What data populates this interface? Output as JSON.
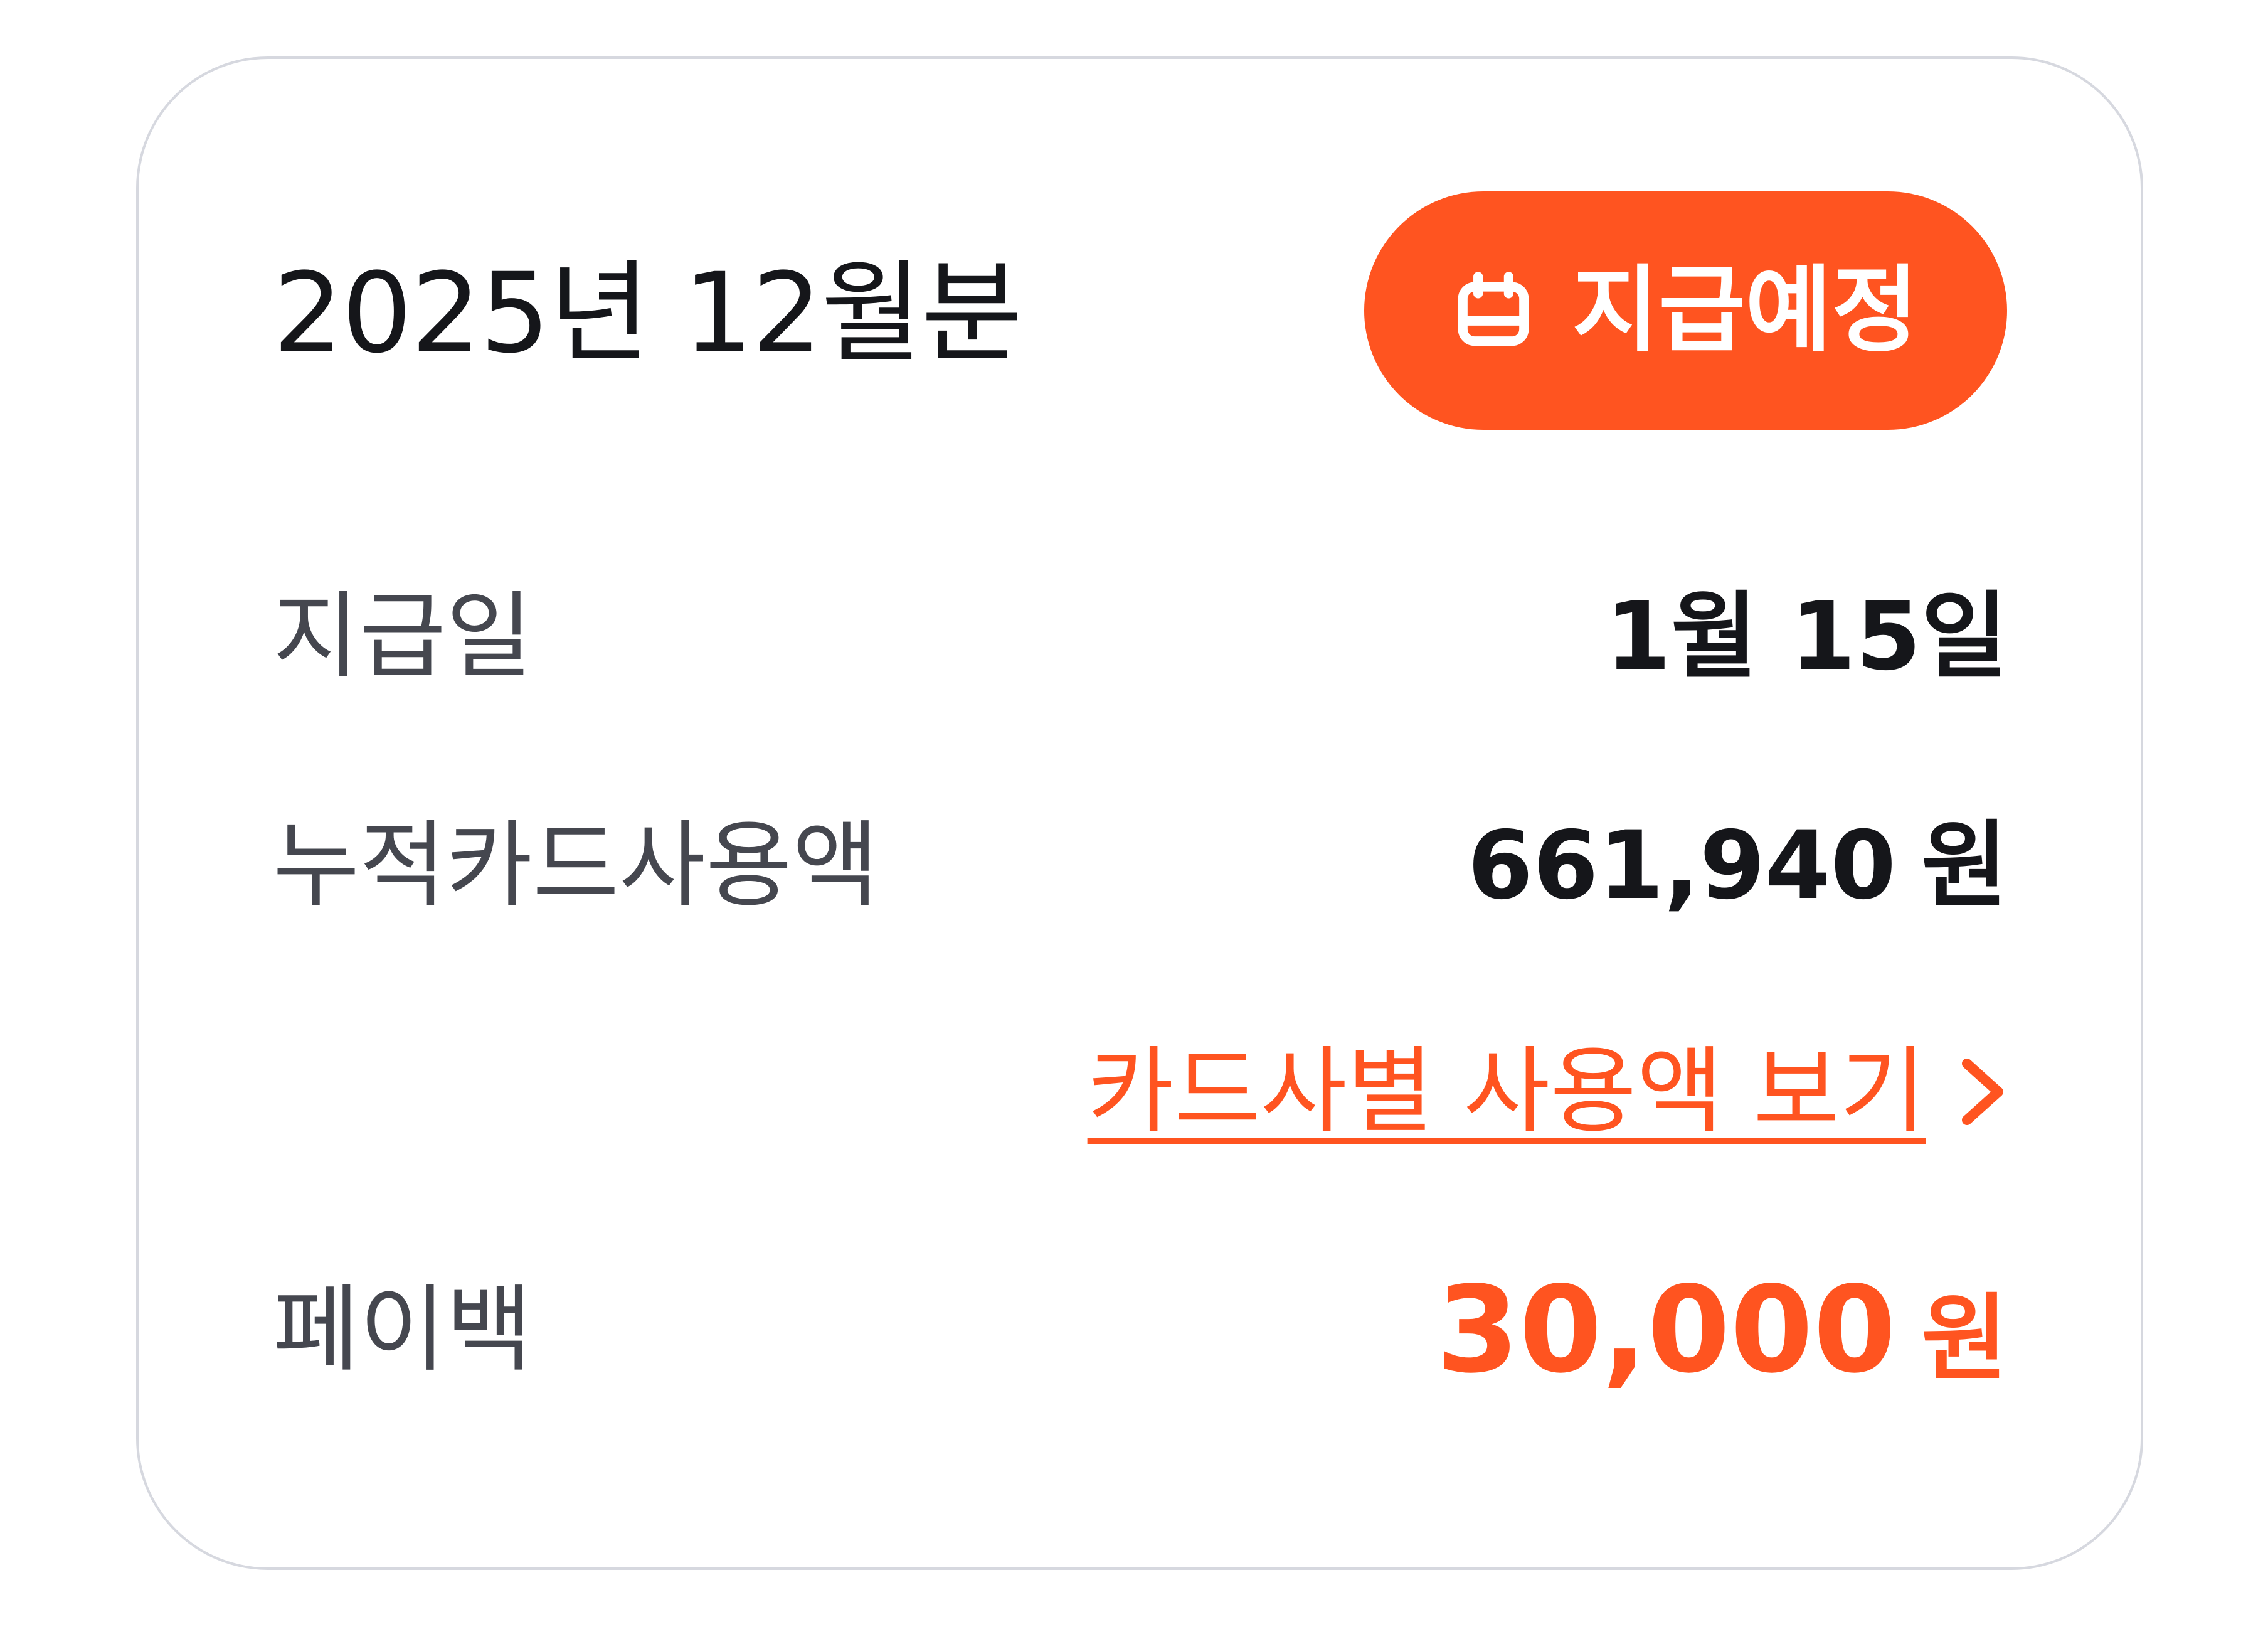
{
  "card": {
    "period_title": "2025년 12월분",
    "status_badge": {
      "icon": "calendar-icon",
      "label": "지급예정",
      "color": "#ff5420"
    },
    "rows": {
      "payment_date": {
        "label": "지급일",
        "value": "1월 15일"
      },
      "card_usage": {
        "label": "누적카드사용액",
        "value": "661,940",
        "unit": "원"
      },
      "payback": {
        "label": "페이백",
        "value": "30,000",
        "unit": "원"
      }
    },
    "card_breakdown_link": {
      "label": "카드사별 사용액 보기",
      "icon": "chevron-right-icon"
    }
  },
  "colors": {
    "accent": "#ff5420",
    "text_primary": "#15161a",
    "text_secondary": "#45474f",
    "border": "#d6d8df"
  }
}
